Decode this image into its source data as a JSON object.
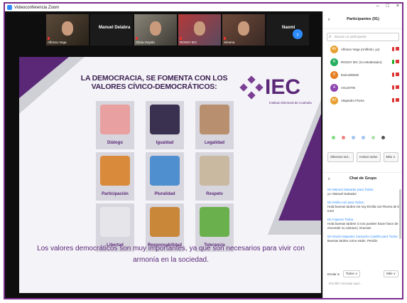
{
  "window": {
    "title": "Videoconferencia Zoom",
    "controls": [
      "–",
      "□",
      "×"
    ]
  },
  "thumbnails": [
    {
      "name": "Alfonso Vega",
      "style": "t1"
    },
    {
      "name": "Manuel Delabra",
      "style": "t2",
      "display": "Manuel Delabra"
    },
    {
      "name": "Olivia Gaytán",
      "style": "t3"
    },
    {
      "name": "ROSSY IEC",
      "style": "t4"
    },
    {
      "name": "Ximena",
      "style": "t5"
    },
    {
      "name": "Naomi",
      "style": "t6",
      "display": "Naomi"
    }
  ],
  "slide": {
    "title_line1": "LA DEMOCRACIA, SE FOMENTA CON LOS",
    "title_line2": "VALORES CÍVICO-DEMOCRÁTICOS:",
    "logo_text": "IEC",
    "logo_sub": "Instituto Electoral de Coahuila",
    "cards": [
      {
        "label": "Diálogo",
        "color": "#e8a0a0"
      },
      {
        "label": "Igualdad",
        "color": "#3a3050"
      },
      {
        "label": "Legalidad",
        "color": "#b89070"
      },
      {
        "label": "Participación",
        "color": "#d98a3a"
      },
      {
        "label": "Pluralidad",
        "color": "#4f8fcf"
      },
      {
        "label": "Respeto",
        "color": "#c9b9a0"
      },
      {
        "label": "Libertad",
        "color": "#e6e6ea"
      },
      {
        "label": "Responsabilidad",
        "color": "#c9873a"
      },
      {
        "label": "Tolerancia",
        "color": "#6ab04c"
      }
    ],
    "caption": "Los valores democráticos son muy importantes, ya que son necesarios para vivir con armonía en la sociedad."
  },
  "participants_panel": {
    "title": "Participantes (91)",
    "search_placeholder": "Buscar un participante",
    "participants": [
      {
        "initial": "AV",
        "name": "Alfonso Vega (Anfitrión, yo)",
        "color": "#e8a030",
        "mic_on": false
      },
      {
        "initial": "R",
        "name": "ROSSY IEC (Co-Moderador)",
        "color": "#27ae60",
        "mic_on": true
      },
      {
        "initial": "8",
        "name": "8441300549",
        "color": "#e67e22",
        "mic_on": false
      },
      {
        "initial": "A",
        "name": "AGUSTIN",
        "color": "#8e44ad",
        "mic_on": false
      },
      {
        "initial": "AF",
        "name": "Alejandro Flores",
        "color": "#e8a030",
        "mic_on": false
      }
    ],
    "reaction_colors": [
      "#7fdc7f",
      "#f08080",
      "#a0c4f0",
      "#a0c4f0",
      "#b0e0b0",
      "#555555"
    ],
    "buttons": [
      "Silenciar tod...",
      "Activar todos",
      "Más ∨"
    ]
  },
  "chat": {
    "title": "Chat de Grupo",
    "messages": [
      {
        "from": "De Manuel Salvador para Todos:",
        "text": "yo: Manuel Salvador"
      },
      {
        "from": "De emilia ruiz para Todos:",
        "text": "Hola buenas tardes me soy Emilia ruiz Rivera de la torre"
      },
      {
        "from": "De mujeres Todos:",
        "text": "Hola buenas tardes! si nos pueden hacer favor de encender su cámara | Gracias!"
      },
      {
        "from": "De David Alejandro Camacho Castillo para Todos:",
        "text": "Buenas tardes como están. Perdón"
      }
    ],
    "send_to_label": "Enviar a:",
    "send_to_value": "Todos ∨",
    "more_label": "Más ∨",
    "input_placeholder": "Escribir mensaje aquí..."
  }
}
